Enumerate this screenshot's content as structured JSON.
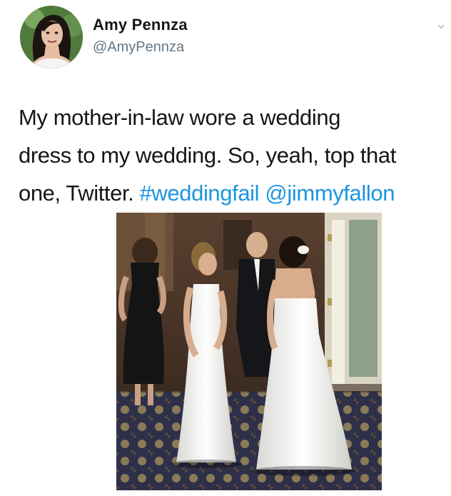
{
  "tweet": {
    "author": {
      "display_name": "Amy Pennza",
      "handle": "@AmyPennza",
      "avatar_icon": "profile-photo"
    },
    "menu_icon": "chevron-down-icon",
    "text_lines": [
      {
        "plain": "My mother-in-law wore a wedding",
        "links": []
      },
      {
        "plain": "dress to my wedding. So, yeah, top that",
        "links": []
      },
      {
        "plain": "one, Twitter. ",
        "links": [
          "#weddingfail",
          "@jimmyfallon"
        ]
      }
    ],
    "link_color": "#1b95e0",
    "text_color": "#14171a",
    "handle_color": "#657786",
    "photo": {
      "subject": "two women in white wedding dresses facing each other in a reception room"
    }
  }
}
